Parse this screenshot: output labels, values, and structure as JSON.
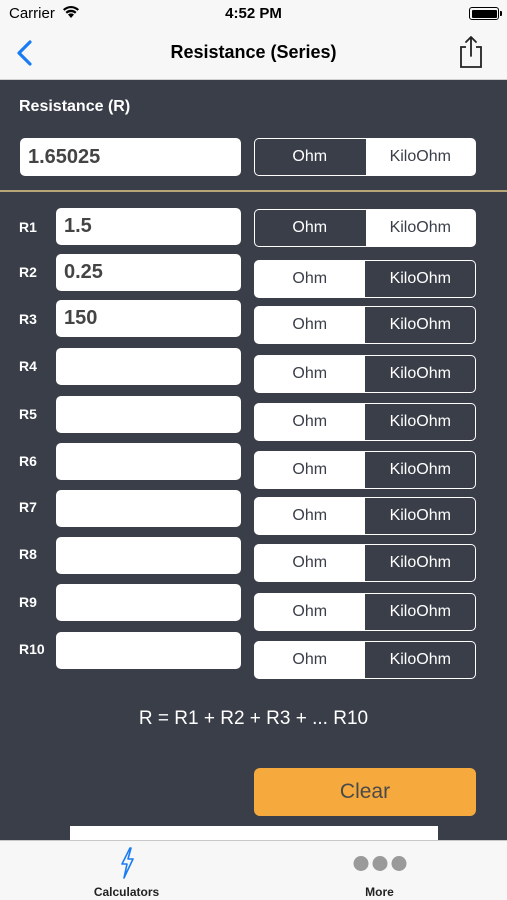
{
  "status_bar": {
    "carrier": "Carrier",
    "time": "4:52 PM"
  },
  "nav": {
    "title": "Resistance (Series)"
  },
  "result": {
    "label": "Resistance (R)",
    "value": "1.65025",
    "unit_options": [
      "Ohm",
      "KiloOhm"
    ],
    "selected": "Ohm"
  },
  "rows": [
    {
      "label": "R1",
      "value": "1.5",
      "selected": "Ohm"
    },
    {
      "label": "R2",
      "value": "0.25",
      "selected": "KiloOhm"
    },
    {
      "label": "R3",
      "value": "150",
      "selected": "KiloOhm"
    },
    {
      "label": "R4",
      "value": "",
      "selected": "KiloOhm"
    },
    {
      "label": "R5",
      "value": "",
      "selected": "KiloOhm"
    },
    {
      "label": "R6",
      "value": "",
      "selected": "KiloOhm"
    },
    {
      "label": "R7",
      "value": "",
      "selected": "KiloOhm"
    },
    {
      "label": "R8",
      "value": "",
      "selected": "KiloOhm"
    },
    {
      "label": "R9",
      "value": "",
      "selected": "KiloOhm"
    },
    {
      "label": "R10",
      "value": "",
      "selected": "KiloOhm"
    }
  ],
  "unit_options": [
    "Ohm",
    "KiloOhm"
  ],
  "formula": "R = R1 + R2 + R3 + ... R10",
  "clear_label": "Clear",
  "tabs": [
    {
      "label": "Calculators",
      "icon": "lightning-icon"
    },
    {
      "label": "More",
      "icon": "more-dots-icon"
    }
  ],
  "colors": {
    "background": "#3a3e48",
    "accent": "#f6a93c",
    "tint": "#1a7cf5",
    "divider": "#b9a678"
  }
}
